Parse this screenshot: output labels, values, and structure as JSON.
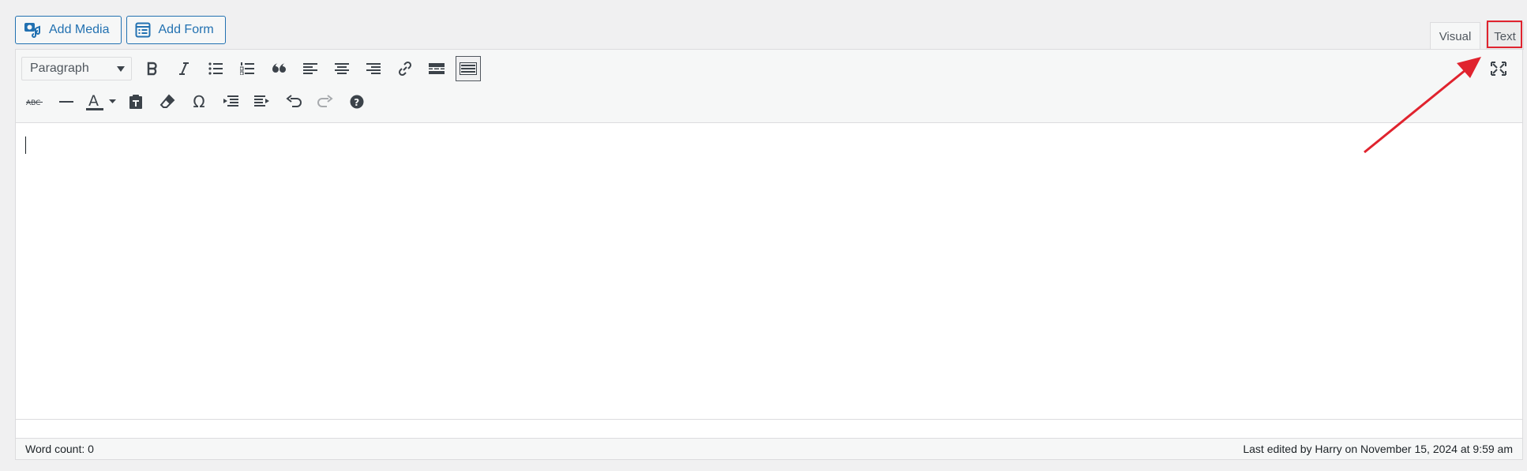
{
  "media_buttons": {
    "add_media": "Add Media",
    "add_form": "Add Form"
  },
  "tabs": {
    "visual": "Visual",
    "text": "Text"
  },
  "toolbar": {
    "format_select": "Paragraph",
    "omega": "Ω",
    "row1_icons": [
      "bold-icon",
      "italic-icon",
      "bulleted-list-icon",
      "numbered-list-icon",
      "blockquote-icon",
      "align-left-icon",
      "align-center-icon",
      "align-right-icon",
      "link-icon",
      "read-more-icon",
      "toolbar-toggle-icon"
    ],
    "row2_icons": [
      "strikethrough-icon",
      "horizontal-line-icon",
      "text-color-icon",
      "paste-as-text-icon",
      "clear-formatting-icon",
      "special-character-icon",
      "outdent-icon",
      "indent-icon",
      "undo-icon",
      "redo-icon",
      "keyboard-shortcuts-icon"
    ],
    "fullscreen_icon": "fullscreen-icon"
  },
  "status": {
    "word_count": "Word count: 0",
    "last_edited": "Last edited by Harry on November 15, 2024 at 9:59 am"
  },
  "colors": {
    "accent": "#2271b1",
    "annotation": "#e0232e"
  }
}
